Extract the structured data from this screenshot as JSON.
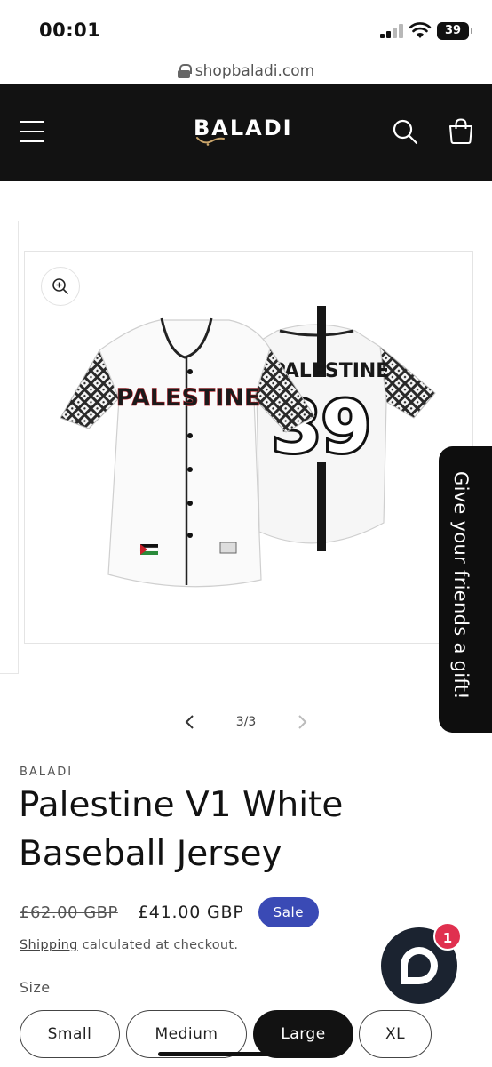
{
  "status_bar": {
    "time": "00:01",
    "battery": "39"
  },
  "browser": {
    "url": "shopbaladi.com"
  },
  "header": {
    "logo_text": "BALADI"
  },
  "gallery": {
    "slide_counter": "3/3",
    "jersey_front_text": "PALESTINE",
    "jersey_back_text": "PALESTINE",
    "jersey_number": "39"
  },
  "gift_tab": {
    "label": "Give your friends a gift!"
  },
  "product": {
    "vendor": "BALADI",
    "title": "Palestine V1 White Baseball Jersey",
    "compare_price": "£62.00 GBP",
    "sale_price": "£41.00 GBP",
    "sale_badge": "Sale",
    "shipping_link": "Shipping",
    "shipping_text": " calculated at checkout.",
    "size_label": "Size",
    "sizes": [
      {
        "label": "Small",
        "selected": false
      },
      {
        "label": "Medium",
        "selected": false
      },
      {
        "label": "Large",
        "selected": true
      },
      {
        "label": "XL",
        "selected": false
      }
    ]
  },
  "chat": {
    "badge_count": "1"
  },
  "colors": {
    "header_bg": "#121212",
    "sale_badge": "#3a4ab5",
    "chat_bg": "#1b2330",
    "chat_badge": "#e0304f"
  }
}
